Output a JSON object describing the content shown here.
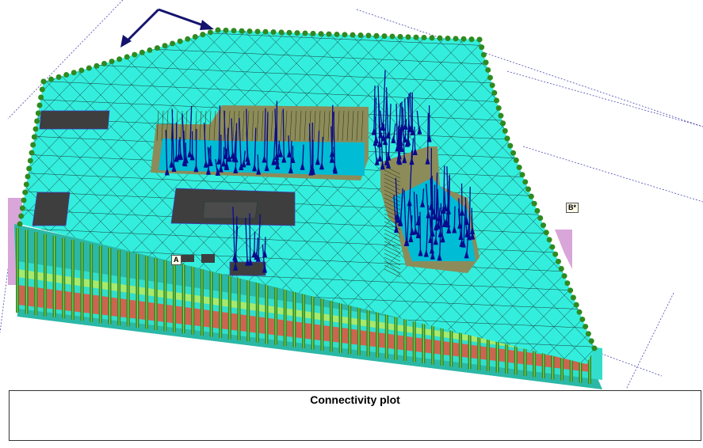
{
  "plot": {
    "caption": "Connectivity plot",
    "point_labels": [
      "A",
      "B*"
    ]
  },
  "colors": {
    "mesh_fill": "#33eedd",
    "mesh_line": "#1a3a3a",
    "edge_rods": "#2f8a1f",
    "excavation_wall": "#8c8c5a",
    "excavation_floor": "#00bcd4",
    "anchors": "#0a0a8c",
    "slab_footprint": "#3e3e3e",
    "lower_layer_red": "#e8503a",
    "lower_layer_yellow": "#f2f230",
    "pink_layer": "#d9a6d9",
    "direction_arrow": "#14146e",
    "guide_lines": "#4a4ab0"
  }
}
